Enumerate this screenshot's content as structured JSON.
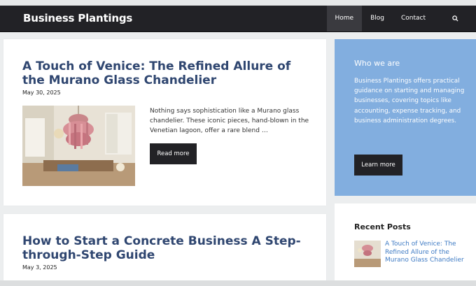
{
  "site": {
    "title": "Business Plantings"
  },
  "nav": {
    "items": [
      "Home",
      "Blog",
      "Contact"
    ],
    "active": "Home",
    "search_icon": "search-icon"
  },
  "posts": [
    {
      "title": "A Touch of Venice: The Refined Allure of the Murano Glass Chandelier",
      "date": "May 30, 2025",
      "excerpt": "Nothing says sophistication like a Murano glass chandelier. These iconic pieces, hand-blown in the Venetian lagoon, offer a rare blend …",
      "read_more": "Read more"
    },
    {
      "title": "How to Start a Concrete Business A Step-through-Step Guide",
      "date": "May 3, 2025"
    }
  ],
  "sidebar": {
    "about": {
      "title": "Who we are",
      "text": "Business Plantings offers practical guidance on starting and managing businesses, covering topics like accounting, expense tracking, and business administration degrees.",
      "button": "Learn more"
    },
    "recent": {
      "title": "Recent Posts",
      "items": [
        "A Touch of Venice: The Refined Allure of the Murano Glass Chandelier"
      ]
    }
  },
  "colors": {
    "nav_bg": "#222226",
    "accent_blue": "#82aedf",
    "title_color": "#2f4670",
    "link_color": "#3f7bc4"
  }
}
